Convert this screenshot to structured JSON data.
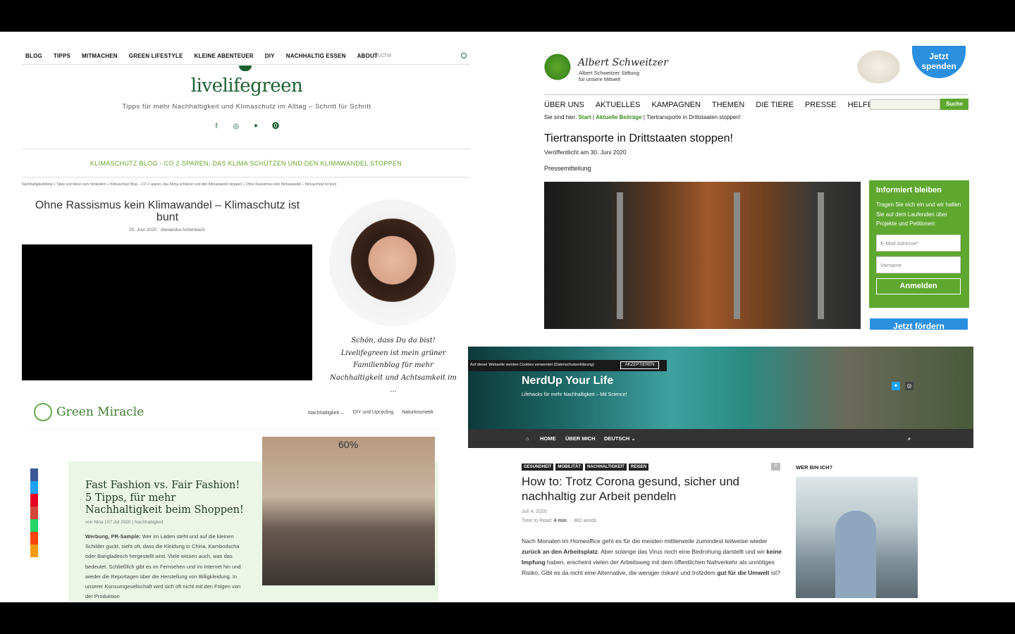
{
  "livelifegreen": {
    "nav": [
      "BLOG",
      "TIPPS",
      "MITMACHEN",
      "GREEN LIFESTYLE",
      "KLEINE ABENTEUER",
      "DIY",
      "NACHHALTIG ESSEN",
      "ABOUT"
    ],
    "search_placeholder": "Suche",
    "logo": "livelifegreen",
    "tagline": "Tipps für mehr Nachhaltigkeit und Klimaschutz im Alltag – Schritt für Schritt",
    "social_icons": [
      "facebook-icon",
      "instagram-icon",
      "twitter-icon",
      "pinterest-icon"
    ],
    "category": "KLIMASCHUTZ BLOG - CO 2 SPAREN, DAS KLIMA SCHÜTZEN UND DEN KLIMAWANDEL STOPPEN",
    "breadcrumb": "Nachhaltigkeitsblog » Tipps und Ideen zum Verändern » Klimaschutz Blog – CO 2 sparen, das Klima schützen und den Klimawandel stoppen » Ohne Rassismus kein Klimawandel – Klimaschutz ist bunt",
    "title": "Ohne Rassismus kein Klimawandel – Klimaschutz ist bunt",
    "date": "25. Juni 2020",
    "author": "Alexandra Achenbach",
    "sidebar_note": "Schön, dass Du da bist! Livelifegreen ist mein grüner Familienblog für mehr Nachhaltigkeit und Achtsamkeit im ..."
  },
  "greenmiracle": {
    "logo": "Green Miracle",
    "nav": [
      "Nachhaltigkeit ⌄",
      "DIY und Upcycling",
      "Naturkosmetik"
    ],
    "title": "Fast Fashion vs. Fair Fashion! 5 Tipps, für mehr Nachhaltigkeit beim Shoppen!",
    "meta": "von Nina | 07 Jul 2020 | Nachhaltigkeit",
    "body_bold": "Werbung, PR-Sample:",
    "body": " Wer im Laden steht und auf die kleinen Schilder guckt, sieht oft, dass die Kleidung in China, Kambodscha oder Bangladesch hergestellt wird. Viele wissen auch, was das bedeutet. Schließlich gibt es im Fernsehen und im Internet hin und wieder die Reportagen über die Herstellung von Billigkleidung. In unserer Konsumgesellschaft wird sich oft nicht mit den Folgen von der Produktion",
    "sale_tag": "60%",
    "share_colors": [
      "#3b5998",
      "#1da1f2",
      "#e60023",
      "#d44638",
      "#25d366",
      "#ff4500",
      "#f39c12"
    ]
  },
  "schweitzer": {
    "logo_script": "Albert Schweitzer",
    "logo_sub1": "Albert Schweitzer Stiftung",
    "logo_sub2": "für unsere Mitwelt",
    "spenden": "Jetzt spenden",
    "nav": [
      "ÜBER UNS",
      "AKTUELLES",
      "KAMPAGNEN",
      "THEMEN",
      "DIE TIERE",
      "PRESSE",
      "HELFEN"
    ],
    "search_button": "Suche",
    "crumb_prefix": "Sie sind hier: ",
    "crumb_start": "Start",
    "crumb_sep": " | ",
    "crumb_news": "Aktuelle Beiträge",
    "crumb_current": " | Tiertransporte in Drittstaaten stoppen!",
    "title": "Tiertransporte in Drittstaaten stoppen!",
    "date": "Veröffentlicht am 30. Juni 2020",
    "label": "Pressemitteilung",
    "newsletter": {
      "heading": "Informiert bleiben",
      "text": "Tragen Sie sich ein und wir halten Sie auf dem Laufenden über Projekte und Petitionen:",
      "email_placeholder": "E-Mail-Adresse*",
      "name_placeholder": "Vorname",
      "button": "Anmelden"
    },
    "foerdern": "Jetzt fördern"
  },
  "nerdup": {
    "cookie_text": "Auf dieser Webseite werden Cookies verwendet (Datenschutzerklärung)",
    "cookie_button": "AKZEPTIEREN",
    "title": "NerdUp Your Life",
    "subtitle": "Lifehacks für mehr Nachhaltigkeit – Mit Science!",
    "nav": [
      "HOME",
      "ÜBER MICH",
      "DEUTSCH ⌄"
    ],
    "tags": [
      "GESUNDHEIT",
      "MOBILITÄT",
      "NACHHALTIGKEIT",
      "REISEN"
    ],
    "comments": "0",
    "article_title": "How to: Trotz Corona gesund, sicher und nachhaltig zur Arbeit pendeln",
    "date": "Juli 4, 2020",
    "read_label": "Time to Read: ",
    "read_time": "4 min",
    "words": "882 words",
    "body_parts": [
      "Nach Monaten im Homeoffice geht es für die meisten mittlerweile zumindest teilweise wieder ",
      "zurück an den Arbeitsplatz",
      ". Aber solange das Virus noch eine Bedrohung darstellt und wir ",
      "keine Impfung",
      " haben, erscheint vielen der Arbeitsweg mit dem öffentlichen Nahverkehr als unnötiges Risiko. Gibt es da nicht eine Alternative, die weniger riskant und trotzdem ",
      "gut für die Umwelt",
      " ist?"
    ],
    "sidebar_heading": "WER BIN ICH?"
  }
}
